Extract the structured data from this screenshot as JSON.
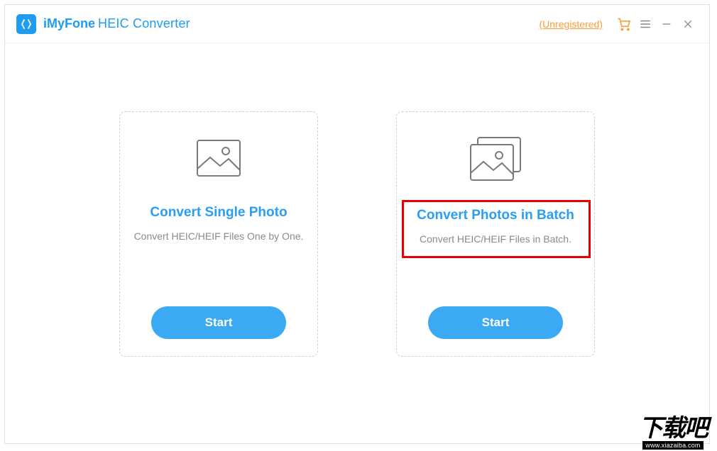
{
  "header": {
    "brand_prefix": "iMyFone",
    "brand_product": "HEIC Converter",
    "unregistered_label": "(Unregistered)"
  },
  "cards": {
    "single": {
      "title": "Convert Single Photo",
      "subtitle": "Convert HEIC/HEIF Files One by One.",
      "button": "Start"
    },
    "batch": {
      "title": "Convert Photos in Batch",
      "subtitle": "Convert HEIC/HEIF Files in Batch.",
      "button": "Start"
    }
  },
  "watermark": {
    "main": "下载吧",
    "url": "www.xiazaiba.com"
  }
}
